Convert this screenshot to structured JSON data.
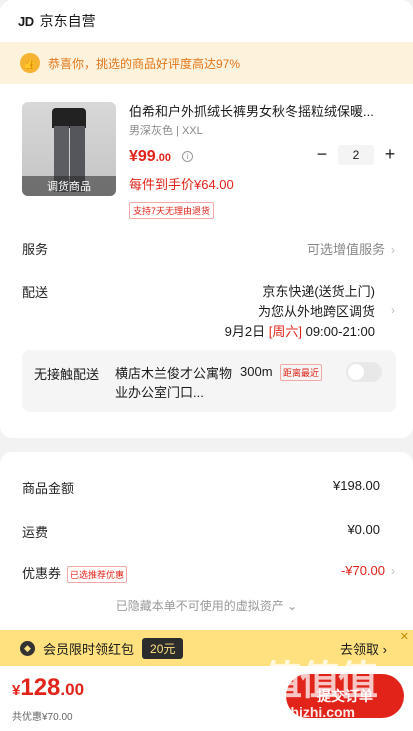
{
  "store": {
    "logo": "JD",
    "name": "京东自营"
  },
  "praise_banner": {
    "text": "恭喜你，挑选的商品好评度高达97%"
  },
  "product": {
    "image_tag": "调货商品",
    "title": "伯希和户外抓绒长裤男女秋冬摇粒绒保暖...",
    "spec": "男深灰色 | XXL",
    "price_main": "¥99",
    "price_decimal": ".00",
    "quantity": "2",
    "unit_price": "每件到手价¥64.00",
    "return_tag": "支持7天无理由退货"
  },
  "service": {
    "label": "服务",
    "value": "可选增值服务"
  },
  "delivery": {
    "label": "配送",
    "line1": "京东快递(送货上门)",
    "line2": "为您从外地跨区调货",
    "date": "9月2日",
    "weekday": "[周六]",
    "time": "09:00-21:00"
  },
  "contactless": {
    "label": "无接触配送",
    "address": "横店木兰俊才公寓物业办公室门口...",
    "distance": "300m",
    "near_tag": "距离最近"
  },
  "summary": {
    "goods_label": "商品金额",
    "goods_value": "¥198.00",
    "shipping_label": "运费",
    "shipping_value": "¥0.00",
    "coupon_label": "优惠券",
    "coupon_tag": "已选推荐优惠",
    "coupon_value": "-¥70.00",
    "hidden_assets": "已隐藏本单不可使用的虚拟资产"
  },
  "member_bar": {
    "text": "会员限时领红包",
    "amount": "20元",
    "claim": "去领取"
  },
  "bottom": {
    "total_yen": "¥",
    "total_int": "128",
    "total_dec": ".00",
    "saved": "共优惠¥70.00",
    "submit": "提交订单"
  },
  "watermark": {
    "text": "值值值",
    "url": "zhizhizhi.com"
  }
}
